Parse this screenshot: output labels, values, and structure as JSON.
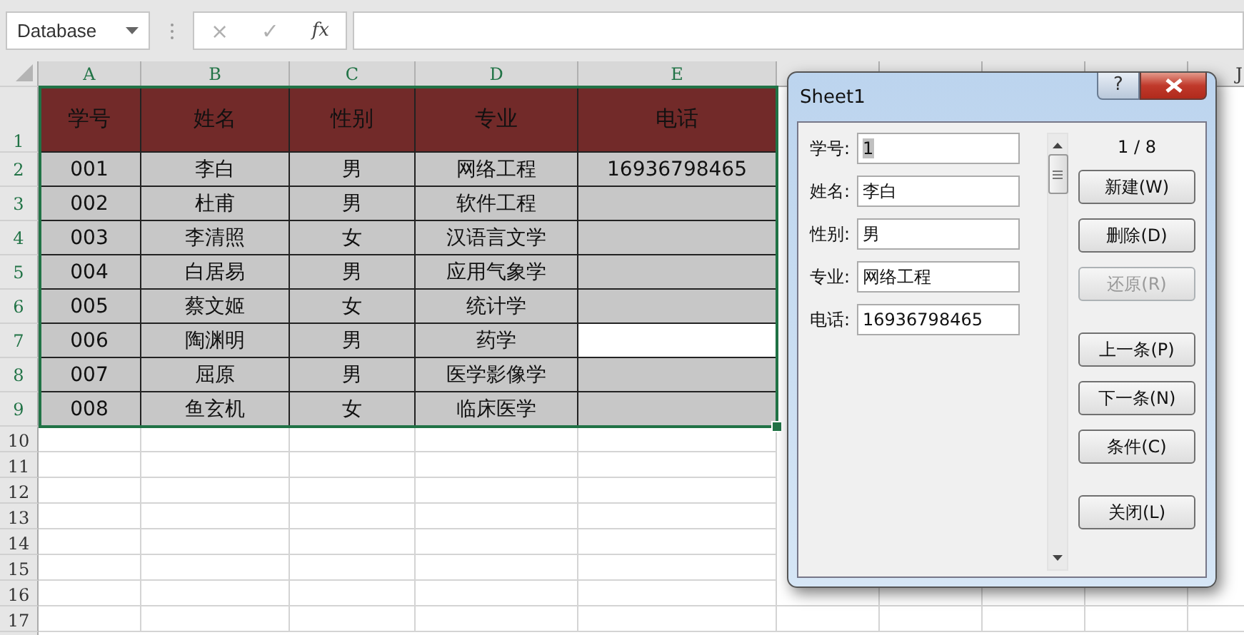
{
  "name_box": {
    "value": "Database"
  },
  "formula_bar": {
    "cancel": "×",
    "enter": "✓",
    "fx": "fx"
  },
  "columns": [
    "A",
    "B",
    "C",
    "D",
    "E"
  ],
  "extra_columns": [
    "",
    "",
    "",
    "",
    "J"
  ],
  "header_row": {
    "number": "1",
    "cells": [
      "学号",
      "姓名",
      "性别",
      "专业",
      "电话"
    ]
  },
  "rows": [
    {
      "number": "2",
      "cells": [
        "001",
        "李白",
        "男",
        "网络工程",
        "16936798465"
      ],
      "phone_filled": true
    },
    {
      "number": "3",
      "cells": [
        "002",
        "杜甫",
        "男",
        "软件工程",
        ""
      ],
      "phone_filled": true
    },
    {
      "number": "4",
      "cells": [
        "003",
        "李清照",
        "女",
        "汉语言文学",
        ""
      ],
      "phone_filled": true
    },
    {
      "number": "5",
      "cells": [
        "004",
        "白居易",
        "男",
        "应用气象学",
        ""
      ],
      "phone_filled": true
    },
    {
      "number": "6",
      "cells": [
        "005",
        "蔡文姬",
        "女",
        "统计学",
        ""
      ],
      "phone_filled": true
    },
    {
      "number": "7",
      "cells": [
        "006",
        "陶渊明",
        "男",
        "药学",
        ""
      ],
      "phone_filled": false
    },
    {
      "number": "8",
      "cells": [
        "007",
        "屈原",
        "男",
        "医学影像学",
        ""
      ],
      "phone_filled": true
    },
    {
      "number": "9",
      "cells": [
        "008",
        "鱼玄机",
        "女",
        "临床医学",
        ""
      ],
      "phone_filled": true
    }
  ],
  "empty_rows": [
    "10",
    "11",
    "12",
    "13",
    "14",
    "15",
    "16",
    "17"
  ],
  "dialog": {
    "title": "Sheet1",
    "help": "?",
    "counter": "1 / 8",
    "fields": [
      {
        "label": "学号:",
        "value": "1"
      },
      {
        "label": "姓名:",
        "value": "李白"
      },
      {
        "label": "性别:",
        "value": "男"
      },
      {
        "label": "专业:",
        "value": "网络工程"
      },
      {
        "label": "电话:",
        "value": "16936798465"
      }
    ],
    "button_groups": [
      [
        {
          "label": "新建(W)",
          "disabled": false
        },
        {
          "label": "删除(D)",
          "disabled": false
        },
        {
          "label": "还原(R)",
          "disabled": true
        }
      ],
      [
        {
          "label": "上一条(P)",
          "disabled": false
        },
        {
          "label": "下一条(N)",
          "disabled": false
        },
        {
          "label": "条件(C)",
          "disabled": false
        }
      ],
      [
        {
          "label": "关闭(L)",
          "disabled": false
        }
      ]
    ]
  }
}
